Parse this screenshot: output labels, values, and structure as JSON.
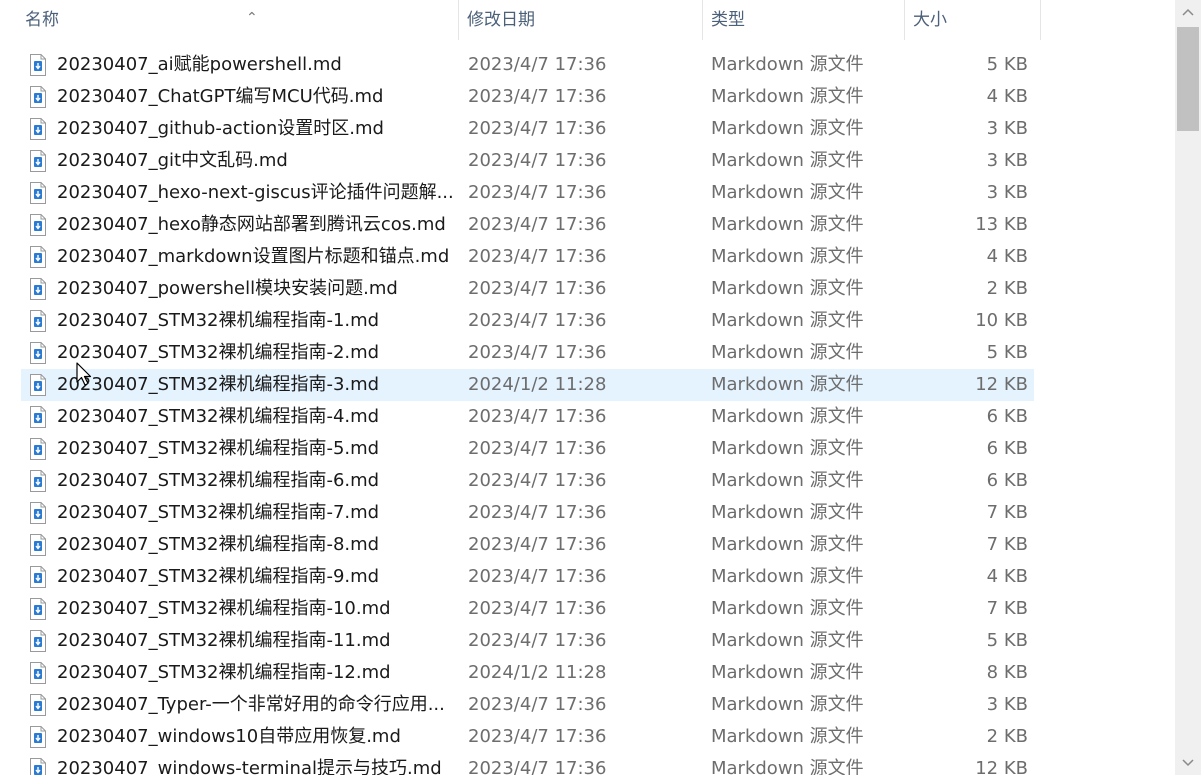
{
  "columns": {
    "name": "名称",
    "date": "修改日期",
    "type": "类型",
    "size": "大小"
  },
  "sort_indicator": "sort-ascending-arrow",
  "hovered_row_index": 10,
  "files": [
    {
      "name": "20230407_ai赋能powershell.md",
      "date": "2023/4/7 17:36",
      "type": "Markdown 源文件",
      "size": "5 KB"
    },
    {
      "name": "20230407_ChatGPT编写MCU代码.md",
      "date": "2023/4/7 17:36",
      "type": "Markdown 源文件",
      "size": "4 KB"
    },
    {
      "name": "20230407_github-action设置时区.md",
      "date": "2023/4/7 17:36",
      "type": "Markdown 源文件",
      "size": "3 KB"
    },
    {
      "name": "20230407_git中文乱码.md",
      "date": "2023/4/7 17:36",
      "type": "Markdown 源文件",
      "size": "3 KB"
    },
    {
      "name": "20230407_hexo-next-giscus评论插件问题解...",
      "date": "2023/4/7 17:36",
      "type": "Markdown 源文件",
      "size": "3 KB"
    },
    {
      "name": "20230407_hexo静态网站部署到腾讯云cos.md",
      "date": "2023/4/7 17:36",
      "type": "Markdown 源文件",
      "size": "13 KB"
    },
    {
      "name": "20230407_markdown设置图片标题和锚点.md",
      "date": "2023/4/7 17:36",
      "type": "Markdown 源文件",
      "size": "4 KB"
    },
    {
      "name": "20230407_powershell模块安装问题.md",
      "date": "2023/4/7 17:36",
      "type": "Markdown 源文件",
      "size": "2 KB"
    },
    {
      "name": "20230407_STM32裸机编程指南-1.md",
      "date": "2023/4/7 17:36",
      "type": "Markdown 源文件",
      "size": "10 KB"
    },
    {
      "name": "20230407_STM32裸机编程指南-2.md",
      "date": "2023/4/7 17:36",
      "type": "Markdown 源文件",
      "size": "5 KB"
    },
    {
      "name": "20230407_STM32裸机编程指南-3.md",
      "date": "2024/1/2 11:28",
      "type": "Markdown 源文件",
      "size": "12 KB"
    },
    {
      "name": "20230407_STM32裸机编程指南-4.md",
      "date": "2023/4/7 17:36",
      "type": "Markdown 源文件",
      "size": "6 KB"
    },
    {
      "name": "20230407_STM32裸机编程指南-5.md",
      "date": "2023/4/7 17:36",
      "type": "Markdown 源文件",
      "size": "6 KB"
    },
    {
      "name": "20230407_STM32裸机编程指南-6.md",
      "date": "2023/4/7 17:36",
      "type": "Markdown 源文件",
      "size": "6 KB"
    },
    {
      "name": "20230407_STM32裸机编程指南-7.md",
      "date": "2023/4/7 17:36",
      "type": "Markdown 源文件",
      "size": "7 KB"
    },
    {
      "name": "20230407_STM32裸机编程指南-8.md",
      "date": "2023/4/7 17:36",
      "type": "Markdown 源文件",
      "size": "7 KB"
    },
    {
      "name": "20230407_STM32裸机编程指南-9.md",
      "date": "2023/4/7 17:36",
      "type": "Markdown 源文件",
      "size": "4 KB"
    },
    {
      "name": "20230407_STM32裸机编程指南-10.md",
      "date": "2023/4/7 17:36",
      "type": "Markdown 源文件",
      "size": "7 KB"
    },
    {
      "name": "20230407_STM32裸机编程指南-11.md",
      "date": "2023/4/7 17:36",
      "type": "Markdown 源文件",
      "size": "5 KB"
    },
    {
      "name": "20230407_STM32裸机编程指南-12.md",
      "date": "2024/1/2 11:28",
      "type": "Markdown 源文件",
      "size": "8 KB"
    },
    {
      "name": "20230407_Typer-一个非常好用的命令行应用...",
      "date": "2023/4/7 17:36",
      "type": "Markdown 源文件",
      "size": "3 KB"
    },
    {
      "name": "20230407_windows10自带应用恢复.md",
      "date": "2023/4/7 17:36",
      "type": "Markdown 源文件",
      "size": "2 KB"
    },
    {
      "name": "20230407_windows-terminal提示与技巧.md",
      "date": "2023/4/7 17:36",
      "type": "Markdown 源文件",
      "size": "12 KB"
    }
  ],
  "colors": {
    "header_text": "#4c607a",
    "hover_bg": "#e5f3ff",
    "icon_accent": "#2b7bd3"
  }
}
